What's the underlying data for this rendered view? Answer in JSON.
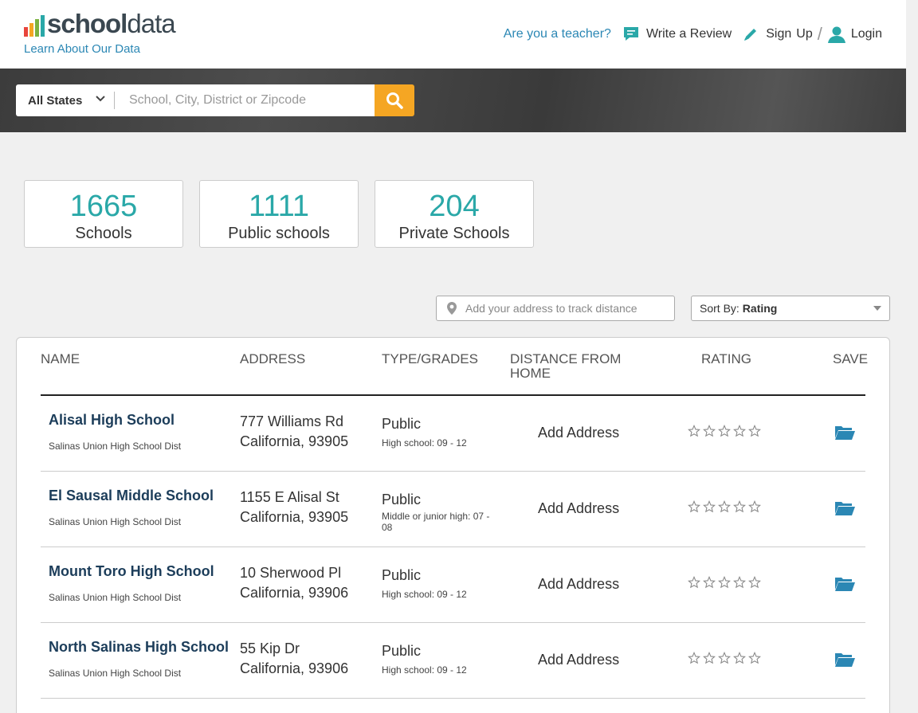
{
  "brand": {
    "name_bold": "school",
    "name_light": "data",
    "tagline": "Learn About Our Data",
    "bar_colors": [
      "#e8453c",
      "#f5a623",
      "#7cb342",
      "#2aa8a8"
    ]
  },
  "nav": {
    "teacher": "Are you a teacher?",
    "review": "Write a Review",
    "sign": "Sign",
    "up": "Up",
    "slash": "/",
    "login": "Login"
  },
  "search": {
    "state": "All States",
    "placeholder": "School, City, District or Zipcode",
    "icons": {
      "submit": "search-icon",
      "state": "chevron-down-icon"
    }
  },
  "stats": [
    {
      "value": "1665",
      "label": "Schools"
    },
    {
      "value": "1111",
      "label": "Public schools"
    },
    {
      "value": "204",
      "label": "Private Schools"
    }
  ],
  "controls": {
    "address_placeholder": "Add your address to track distance",
    "sort_label": "Sort By:",
    "sort_value": "Rating"
  },
  "table": {
    "headers": {
      "name": "NAME",
      "address": "ADDRESS",
      "type": "TYPE/GRADES",
      "distance_1": "DISTANCE FROM",
      "distance_2": "HOME",
      "rating": "RATING",
      "save": "SAVE"
    },
    "rows": [
      {
        "name": "Alisal High School",
        "district": "Salinas Union High School Dist",
        "street": "777 Williams Rd",
        "city": "California, 93905",
        "type": "Public",
        "grades": "High school: 09 - 12",
        "distance": "Add Address",
        "rating": 0
      },
      {
        "name": "El Sausal Middle School",
        "district": "Salinas Union High School Dist",
        "street": "1155 E Alisal St",
        "city": "California, 93905",
        "type": "Public",
        "grades": "Middle or junior high: 07 - 08",
        "distance": "Add Address",
        "rating": 0
      },
      {
        "name": "Mount Toro High School",
        "district": "Salinas Union High School Dist",
        "street": "10 Sherwood Pl",
        "city": "California, 93906",
        "type": "Public",
        "grades": "High school: 09 - 12",
        "distance": "Add Address",
        "rating": 0
      },
      {
        "name": "North Salinas High School",
        "district": "Salinas Union High School Dist",
        "street": "55 Kip Dr",
        "city": "California, 93906",
        "type": "Public",
        "grades": "High school: 09 - 12",
        "distance": "Add Address",
        "rating": 0
      }
    ]
  },
  "colors": {
    "accent": "#2aa8a8",
    "link": "#2b87b4",
    "search_button": "#f5a623",
    "folder": "#2b87b4",
    "school_name": "#1c3d5a"
  }
}
